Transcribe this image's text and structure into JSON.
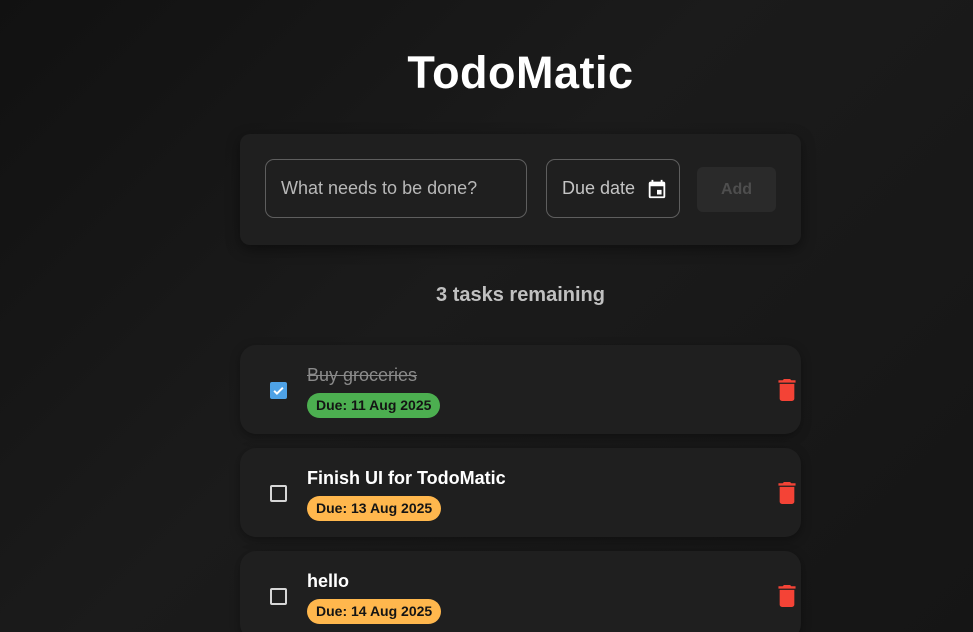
{
  "app": {
    "title": "TodoMatic"
  },
  "form": {
    "task_placeholder": "What needs to be done?",
    "task_value": "",
    "date_label": "Due date",
    "date_icon": "calendar-icon",
    "add_label": "Add"
  },
  "summary": {
    "remaining_text": "3 tasks remaining"
  },
  "colors": {
    "background": "#151515",
    "card": "#1f1f1f",
    "checkbox_checked": "#4ea2e6",
    "due_green": "#4caf50",
    "due_orange": "#ffb74d",
    "delete_red": "#f44336"
  },
  "tasks": [
    {
      "name": "Buy groceries",
      "completed": true,
      "due": "Due: 11 Aug 2025",
      "due_color": "#4caf50"
    },
    {
      "name": "Finish UI for TodoMatic",
      "completed": false,
      "due": "Due: 13 Aug 2025",
      "due_color": "#ffb74d"
    },
    {
      "name": "hello",
      "completed": false,
      "due": "Due: 14 Aug 2025",
      "due_color": "#ffb74d"
    }
  ]
}
